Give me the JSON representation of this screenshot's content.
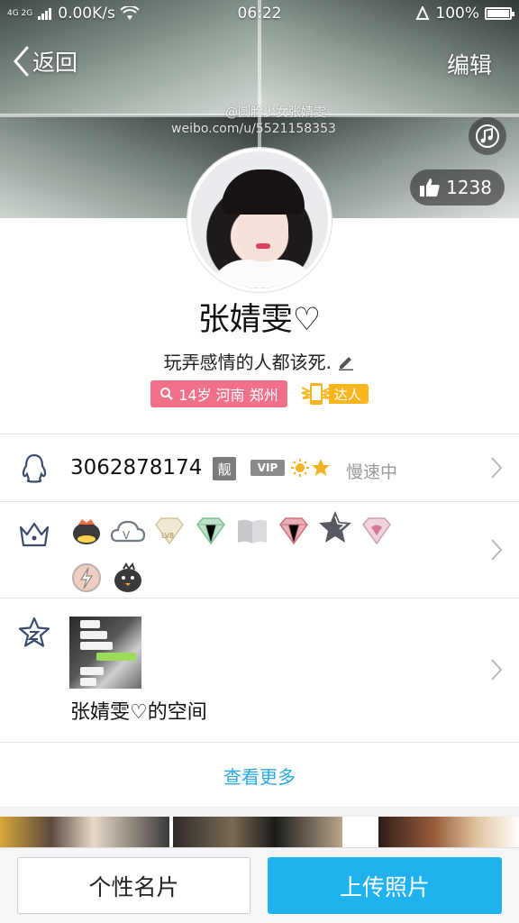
{
  "status_bar": {
    "network": "4G 2G",
    "speed": "0.00K/s",
    "time": "06:22",
    "battery": "100%"
  },
  "header": {
    "back_label": "返回",
    "edit_label": "编辑"
  },
  "cover": {
    "watermark_handle": "@圆脸少女张婧雯",
    "watermark_url": "weibo.com/u/5521158353",
    "likes": "1238"
  },
  "profile": {
    "nickname": "张婧雯♡",
    "signature": "玩弄感情的人都该死.",
    "location_tag": "14岁 河南 郑州",
    "daren_label": "达人"
  },
  "qq_row": {
    "qq_number": "3062878174",
    "liang_badge": "靓",
    "vip_badge": "VIP",
    "speed_status": "慢速中"
  },
  "space_row": {
    "title": "张婧雯♡的空间"
  },
  "more_link": "查看更多",
  "bottom_bar": {
    "card_button": "个性名片",
    "upload_button": "上传照片"
  },
  "colors": {
    "accent_blue": "#1fb2ee",
    "link_blue": "#2ba9e4",
    "location_pink": "#f0708a",
    "daren_orange": "#f8b51d"
  },
  "icons": [
    "back-chevron-icon",
    "music-icon",
    "thumbs-up-icon",
    "search-icon",
    "edit-pencil-icon",
    "qq-penguin-icon",
    "crown-icon",
    "star-icon",
    "chevron-right-icon"
  ]
}
